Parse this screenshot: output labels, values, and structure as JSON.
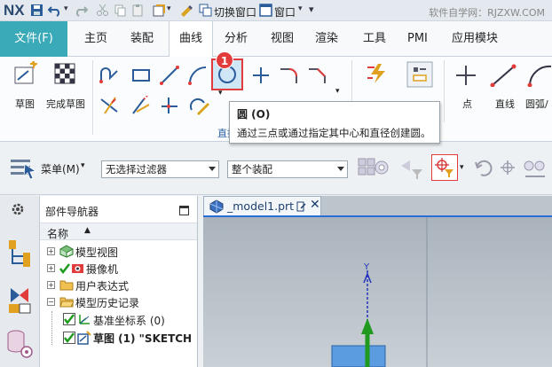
{
  "titlebar": {
    "logo": "NX",
    "switch_window": "切换窗口",
    "window_menu": "窗口",
    "watermark": "软件自学网：RJZXW.COM"
  },
  "tabs": [
    {
      "label": "文件(F)"
    },
    {
      "label": "主页"
    },
    {
      "label": "装配"
    },
    {
      "label": "曲线"
    },
    {
      "label": "分析"
    },
    {
      "label": "视图"
    },
    {
      "label": "渲染"
    },
    {
      "label": "工具"
    },
    {
      "label": "PMI"
    },
    {
      "label": "应用模块"
    }
  ],
  "ribbon": {
    "sketch_label": "草图",
    "finish_sketch_label": "完成草图",
    "group_label": "直接草图",
    "badge": "1",
    "point_label": "点",
    "line_label": "直线",
    "arc_label": "圆弧/"
  },
  "tooltip": {
    "title": "圆 (O)",
    "description": "通过三点或通过指定其中心和直径创建圆。"
  },
  "toolbar2": {
    "menu_label": "菜单(M)",
    "filter_value": "无选择过滤器",
    "scope_value": "整个装配"
  },
  "navigator": {
    "title": "部件导航器",
    "column_name": "名称",
    "items": [
      {
        "label": "模型视图"
      },
      {
        "label": "摄像机"
      },
      {
        "label": "用户表达式"
      },
      {
        "label": "模型历史记录"
      },
      {
        "label": "基准坐标系 (0)"
      },
      {
        "label": "草图 (1) \"SKETCH"
      }
    ]
  },
  "document": {
    "tab_label": "_model1.prt"
  },
  "colors": {
    "file_tab": "#3aa9b8",
    "highlight": "#e23b3b",
    "group_label": "#2c64a8"
  }
}
